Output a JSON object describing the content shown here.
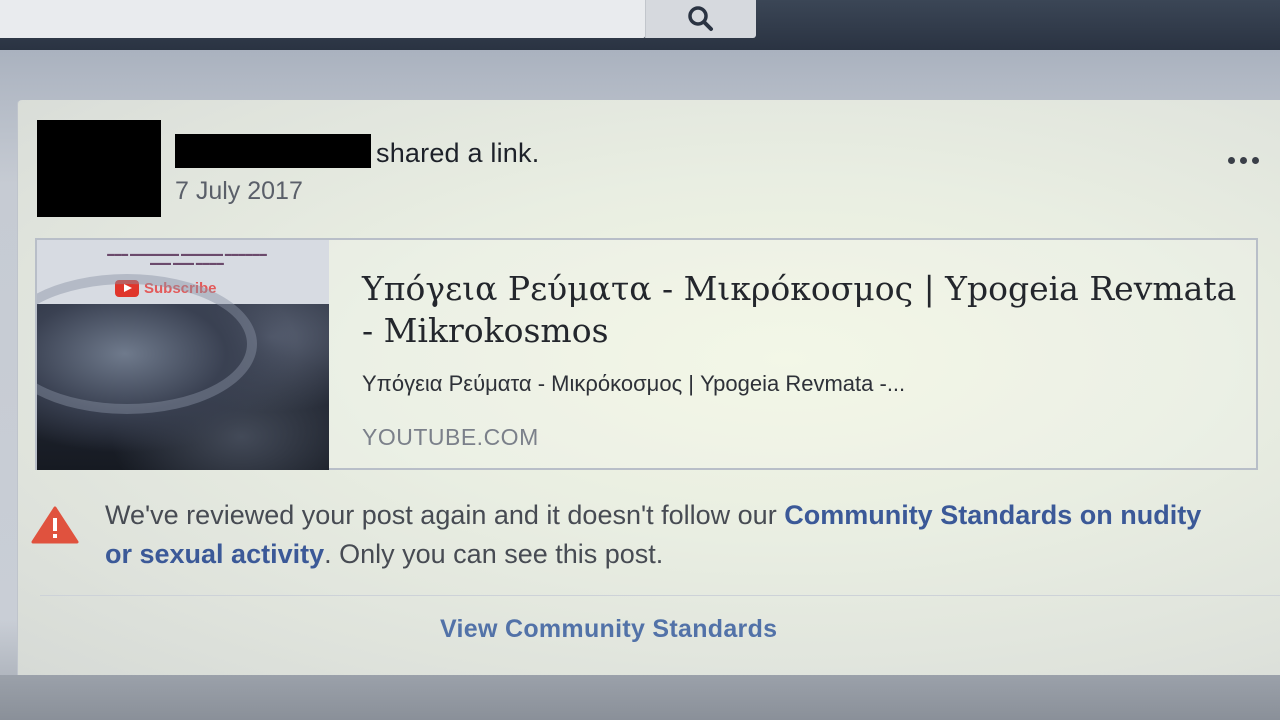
{
  "post": {
    "action_text": "shared a link.",
    "date": "7 July 2017",
    "more_icon": "more-horizontal-icon"
  },
  "link_preview": {
    "title": "Υπόγεια Ρεύματα - Μικρόκοσμος | Ypogeia Revmata - Mikrokosmos",
    "description": "Υπόγεια Ρεύματα - Μικρόκοσμος | Ypogeia Revmata -...",
    "domain": "YOUTUBE.COM",
    "thumbnail": {
      "subscribe_label": "Subscribe"
    }
  },
  "notice": {
    "text_before": "We've reviewed your post again and it doesn't follow our ",
    "link_text": "Community Standards on nudity or sexual activity",
    "text_after": ". Only you can see this post.",
    "icon": "warning-triangle-icon",
    "icon_color": "#e0523e"
  },
  "footer": {
    "view_standards_label": "View Community Standards"
  },
  "colors": {
    "link_blue": "#3b5998",
    "topbar": "#2f3948"
  }
}
